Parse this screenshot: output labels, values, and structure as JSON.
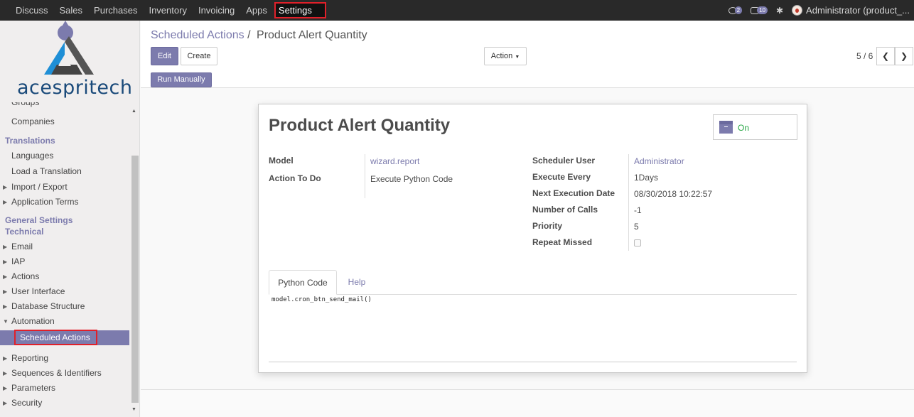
{
  "topbar": {
    "menu": [
      "Discuss",
      "Sales",
      "Purchases",
      "Inventory",
      "Invoicing",
      "Apps",
      "Settings"
    ],
    "active": "Settings",
    "chat_count": "2",
    "activity_count": "10",
    "user": "Administrator (product_..."
  },
  "sidebar": {
    "logo_text": "acespritech",
    "items": [
      {
        "label": "Groups",
        "type": "item"
      },
      {
        "label": "Companies",
        "type": "item"
      },
      {
        "label": "Translations",
        "type": "section"
      },
      {
        "label": "Languages",
        "type": "item"
      },
      {
        "label": "Load a Translation",
        "type": "item"
      },
      {
        "label": "Import / Export",
        "type": "collapsed"
      },
      {
        "label": "Application Terms",
        "type": "collapsed"
      },
      {
        "label": "General Settings",
        "type": "section"
      },
      {
        "label": "Technical",
        "type": "section"
      },
      {
        "label": "Email",
        "type": "collapsed"
      },
      {
        "label": "IAP",
        "type": "collapsed"
      },
      {
        "label": "Actions",
        "type": "collapsed"
      },
      {
        "label": "User Interface",
        "type": "collapsed"
      },
      {
        "label": "Database Structure",
        "type": "collapsed"
      },
      {
        "label": "Automation",
        "type": "expanded"
      },
      {
        "label": "Scheduled Actions",
        "type": "selected"
      },
      {
        "label": "Reporting",
        "type": "collapsed"
      },
      {
        "label": "Sequences & Identifiers",
        "type": "collapsed"
      },
      {
        "label": "Parameters",
        "type": "collapsed"
      },
      {
        "label": "Security",
        "type": "collapsed"
      }
    ]
  },
  "breadcrumb": {
    "parent": "Scheduled Actions",
    "separator": "/",
    "current": "Product Alert Quantity"
  },
  "toolbar": {
    "edit": "Edit",
    "create": "Create",
    "action": "Action",
    "run_manually": "Run Manually"
  },
  "pager": {
    "text": "5 / 6"
  },
  "record": {
    "title": "Product Alert Quantity",
    "active_label": "On",
    "left_fields": [
      {
        "label": "Model",
        "value": "wizard.report",
        "link": true
      },
      {
        "label": "Action To Do",
        "value": "Execute Python Code",
        "link": false
      }
    ],
    "right_fields": [
      {
        "label": "Scheduler User",
        "value": "Administrator",
        "link": true
      },
      {
        "label": "Execute Every",
        "value": "1Days"
      },
      {
        "label": "Next Execution Date",
        "value": "08/30/2018 10:22:57"
      },
      {
        "label": "Number of Calls",
        "value": "-1"
      },
      {
        "label": "Priority",
        "value": "5"
      },
      {
        "label": "Repeat Missed",
        "value": ""
      }
    ],
    "tabs": [
      "Python Code",
      "Help"
    ],
    "code": "model.cron_btn_send_mail()"
  },
  "colors": {
    "accent": "#7c7bad",
    "topbar": "#292929",
    "highlight": "#e0202a",
    "on_green": "#28a745"
  }
}
